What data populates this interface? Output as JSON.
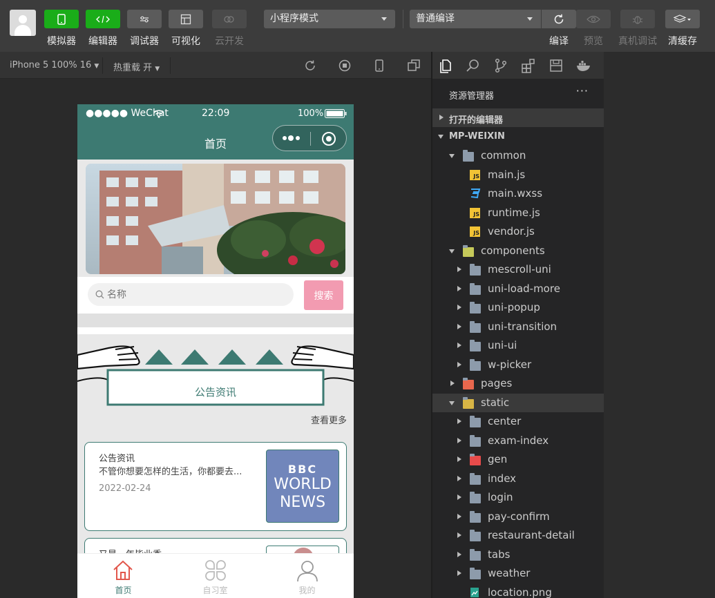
{
  "toolbar": {
    "buttons": [
      {
        "label": "模拟器",
        "icon": "phone-icon"
      },
      {
        "label": "编辑器",
        "icon": "code-icon"
      },
      {
        "label": "调试器",
        "icon": "debug-icon"
      },
      {
        "label": "可视化",
        "icon": "layout-icon"
      },
      {
        "label": "云开发",
        "icon": "cloud-icon"
      }
    ],
    "mode_select": "小程序模式",
    "compile_select": "普通编译",
    "compile_label": "编译",
    "preview_label": "预览",
    "remote_debug_label": "真机调试",
    "clear_cache_label": "清缓存"
  },
  "subbar": {
    "device": "iPhone 5 100% 16",
    "hot_reload": "热重载 开"
  },
  "phone": {
    "status": {
      "carrier": "●●●●● WeChat",
      "time": "22:09",
      "battery": "100%"
    },
    "nav_title": "首页",
    "search": {
      "placeholder": "名称",
      "button": "搜索"
    },
    "notice_banner": "公告资讯",
    "see_more": "查看更多",
    "cards": [
      {
        "title": "公告资讯",
        "desc": "不管你想要怎样的生活，你都要去...",
        "date": "2022-02-24",
        "thumb_lines": [
          "BBC",
          "WORLD",
          "NEWS"
        ]
      },
      {
        "title": "又是一年毕业季"
      }
    ],
    "tabs": [
      {
        "label": "首页",
        "icon": "home-icon",
        "active": true
      },
      {
        "label": "自习室",
        "icon": "grid-icon",
        "active": false
      },
      {
        "label": "我的",
        "icon": "user-icon",
        "active": false
      }
    ]
  },
  "explorer": {
    "title": "资源管理器",
    "more": "···",
    "open_editors": "打开的编辑器",
    "project": "MP-WEIXIN",
    "tree": [
      {
        "name": "common",
        "level": 1,
        "type": "folder",
        "open": true
      },
      {
        "name": "main.js",
        "level": 2,
        "type": "js"
      },
      {
        "name": "main.wxss",
        "level": 2,
        "type": "css"
      },
      {
        "name": "runtime.js",
        "level": 2,
        "type": "js"
      },
      {
        "name": "vendor.js",
        "level": 2,
        "type": "js"
      },
      {
        "name": "components",
        "level": 1,
        "type": "folder-special",
        "open": true
      },
      {
        "name": "mescroll-uni",
        "level": 2,
        "type": "folder"
      },
      {
        "name": "uni-load-more",
        "level": 2,
        "type": "folder"
      },
      {
        "name": "uni-popup",
        "level": 2,
        "type": "folder"
      },
      {
        "name": "uni-transition",
        "level": 2,
        "type": "folder"
      },
      {
        "name": "uni-ui",
        "level": 2,
        "type": "folder"
      },
      {
        "name": "w-picker",
        "level": 2,
        "type": "folder"
      },
      {
        "name": "pages",
        "level": 1,
        "type": "folder-pages"
      },
      {
        "name": "static",
        "level": 1,
        "type": "folder-static",
        "open": true,
        "selected": true
      },
      {
        "name": "center",
        "level": 2,
        "type": "folder"
      },
      {
        "name": "exam-index",
        "level": 2,
        "type": "folder"
      },
      {
        "name": "gen",
        "level": 2,
        "type": "folder-red"
      },
      {
        "name": "index",
        "level": 2,
        "type": "folder"
      },
      {
        "name": "login",
        "level": 2,
        "type": "folder"
      },
      {
        "name": "pay-confirm",
        "level": 2,
        "type": "folder"
      },
      {
        "name": "restaurant-detail",
        "level": 2,
        "type": "folder"
      },
      {
        "name": "tabs",
        "level": 2,
        "type": "folder"
      },
      {
        "name": "weather",
        "level": 2,
        "type": "folder"
      },
      {
        "name": "location.png",
        "level": 2,
        "type": "image"
      }
    ]
  },
  "colors": {
    "accent_green": "#1aad19",
    "phone_theme": "#3d7a72",
    "search_button": "#f29bb1",
    "tab_active": "#e2574c"
  }
}
